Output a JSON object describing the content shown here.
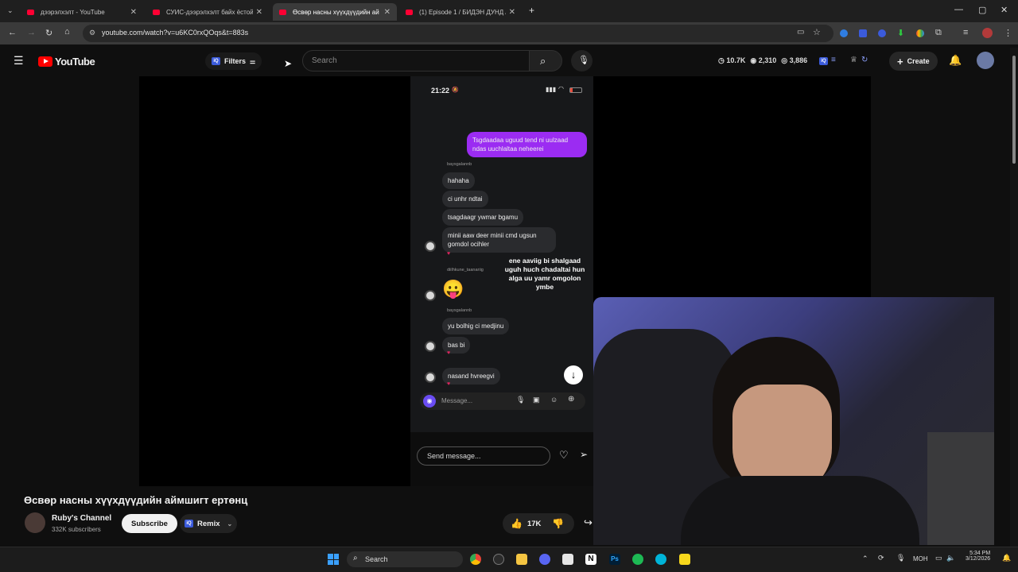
{
  "browser": {
    "tabs": [
      {
        "title": "дээрэлхэлт - YouTube",
        "active": false
      },
      {
        "title": "СУИС-дээрэлхэлт байх ёстой г",
        "active": false
      },
      {
        "title": "Өсвөр насны хүүхдүүдийн ай",
        "active": true
      },
      {
        "title": "(1) Episode 1 / БИДЭН ДУНД /",
        "active": false
      }
    ],
    "url": "youtube.com/watch?v=u6KC0rxQOqs&t=883s"
  },
  "youtube": {
    "logo_text": "YouTube",
    "filters_label": "Filters",
    "search_placeholder": "Search",
    "stats": {
      "views": "10.7K",
      "likes": "2,310",
      "comments": "3,886"
    },
    "create_label": "Create"
  },
  "video_frame": {
    "phone_time": "21:22",
    "sent_message": "Tsgdaadaa uguud tend ni uulzaad ndas uuchlaltaa neheerei",
    "username_1": "baysgalannb",
    "username_2": "diilhkune_taanariig",
    "username_3": "baysgalannb",
    "messages": [
      "hahaha",
      "ci unhr ndtai",
      "tsagdaagr ywmar bgamu",
      "minii aaw deer minii cmd ugsun gomdol ocihler",
      "yu bolhig ci medjinu",
      "bas bi",
      "nasand hvreegvi"
    ],
    "emoji": "😛",
    "overlay_caption": "ene aaviig bi shalgaad uguh huch chadaltai hun alga uu yamr omgolon ymbe",
    "message_placeholder": "Message...",
    "send_message_placeholder": "Send message..."
  },
  "watch": {
    "title": "Өсвөр насны хүүхдүүдийн аймшигт ертөнц",
    "channel_name": "Ruby's Channel",
    "subscribers": "332K subscribers",
    "subscribe_label": "Subscribe",
    "remix_label": "Remix",
    "like_count": "17K"
  },
  "taskbar": {
    "search_label": "Search",
    "language": "MOH",
    "time": "5:34 PM",
    "date": "3/12/2026"
  },
  "colors": {
    "youtube_red": "#ff0000",
    "sent_bubble": "#9b2cf2",
    "iq_blue": "#3b5bdb"
  }
}
